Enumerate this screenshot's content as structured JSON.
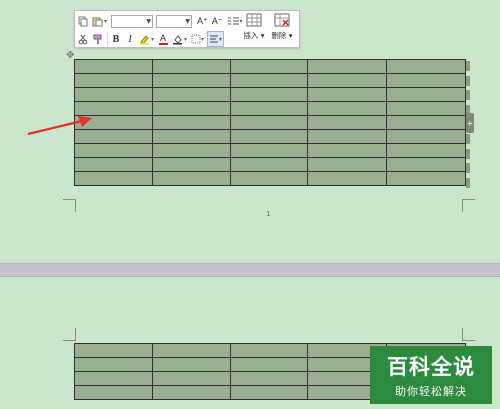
{
  "toolbar": {
    "row1": {
      "copy_icon": "copy-icon",
      "paste_icon": "paste-icon",
      "font_name_value": "",
      "font_size_value": "",
      "grow_font_label": "A⁺",
      "shrink_font_label": "A⁻",
      "line_spacing_icon": "line-spacing-icon"
    },
    "row2": {
      "cut_icon": "cut-icon",
      "format_painter_icon": "format-painter-icon",
      "bold_label": "B",
      "italic_label": "I",
      "highlight_icon": "highlight-icon",
      "font_color_label": "A",
      "shading_icon": "shading-icon",
      "borders_icon": "borders-icon",
      "align_icon": "align-icon"
    },
    "insert_label": "插入",
    "delete_label": "删除"
  },
  "document": {
    "page_number": "1"
  },
  "tables": {
    "top": {
      "rows": 9,
      "cols": 5,
      "cell_fill": "#9aae92"
    },
    "bottom": {
      "rows": 4,
      "cols": 5,
      "cell_fill": "#9aae92"
    }
  },
  "annotation": {
    "arrow_color": "#e0332b"
  },
  "watermark": {
    "title": "百科全说",
    "subtitle": "助你轻松解决",
    "bg_color": "#2c8a3f"
  }
}
